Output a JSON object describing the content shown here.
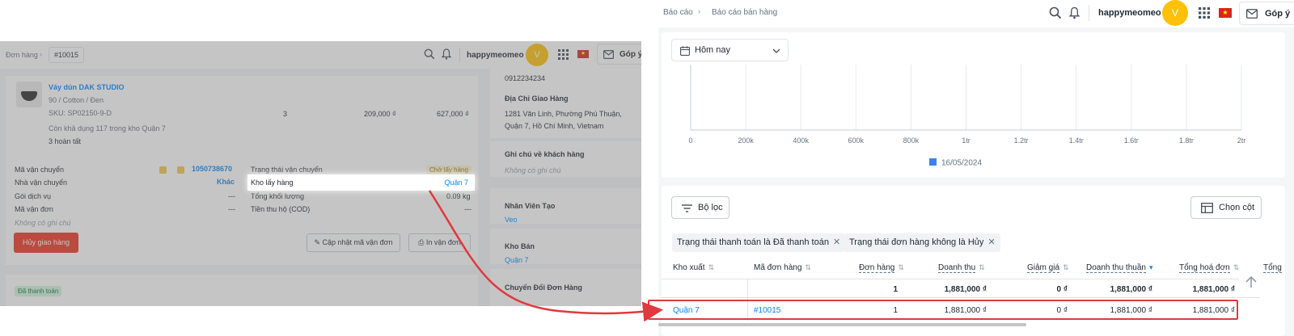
{
  "left_screen": {
    "breadcrumb": {
      "parent": "Đơn hàng",
      "current": "#10015"
    },
    "header": {
      "username": "happymeomeo",
      "avatar_letter": "V",
      "feedback_label": "Góp ý"
    },
    "product": {
      "name": "Váy dún DAK STUDIO",
      "variant": "90 / Cotton / Đen",
      "sku": "SKU: SP02150-9-D",
      "stock_note": "Còn khả dụng 117 trong kho Quận 7",
      "completed": "3 hoàn tất",
      "quantity": "3",
      "unit_price": "209,000 ₫",
      "total": "627,000 ₫"
    },
    "shipping": {
      "tracking_label": "Mã vận chuyển",
      "tracking_value": "1050738670",
      "carrier_label": "Nhà vận chuyển",
      "carrier_value": "Khác",
      "service_label": "Gói dịch vụ",
      "service_value": "---",
      "waybill_label": "Mã vận đơn",
      "waybill_value": "---",
      "no_note": "Không có ghi chú",
      "status_label": "Trạng thái vận chuyển",
      "status_value": "Chờ lấy hàng",
      "warehouse_label": "Kho lấy hàng",
      "warehouse_value": "Quận 7",
      "weight_label": "Tổng khối lượng",
      "weight_value": "0.09 kg",
      "cod_label": "Tiền thu hộ (COD)",
      "cod_value": "---",
      "cancel_label": "Hủy giao hàng",
      "update_label": "Cập nhật mã vận đơn",
      "print_label": "In vận đơn"
    },
    "payment_badge": "Đã thanh toán",
    "side": {
      "phone": "0912234234",
      "address_title": "Địa Chỉ Giao Hàng",
      "address_line1": "1281 Văn Linh, Phường Phú Thuận,",
      "address_line2": "Quận 7, Hồ Chí Minh, Vietnam",
      "customer_note_title": "Ghi chú về khách hàng",
      "customer_note_value": "Không có ghi chú",
      "creator_title": "Nhân Viên Tạo",
      "creator_value": "Veo",
      "store_title": "Kho Bán",
      "store_value": "Quận 7",
      "convert_title": "Chuyển Đổi Đơn Hàng"
    }
  },
  "right_screen": {
    "breadcrumb": {
      "parent": "Báo cáo",
      "current": "Báo cáo bán hàng"
    },
    "header": {
      "username": "happymeomeo",
      "avatar_letter": "V",
      "feedback_label": "Góp ý"
    },
    "date_filter": "Hôm nay",
    "filter_button": "Bộ lọc",
    "columns_button": "Chọn cột",
    "filter_chips": [
      "Trạng thái thanh toán là Đã thanh toán",
      "Trạng thái đơn hàng không là Hủy"
    ],
    "table": {
      "headers": [
        "Kho xuất",
        "Mã đơn hàng",
        "Đơn hàng",
        "Doanh thu",
        "Giảm giá",
        "Doanh thu thuần",
        "Tổng hoá đơn",
        "Tổng"
      ],
      "summary": [
        "",
        "",
        "1",
        "1,881,000 ₫",
        "0 ₫",
        "1,881,000 ₫",
        "1,881,000 ₫"
      ],
      "rows": [
        [
          "Quận 7",
          "#10015",
          "1",
          "1,881,000 ₫",
          "0 ₫",
          "1,881,000 ₫",
          "1,881,000 ₫"
        ]
      ]
    },
    "colors": {
      "highlight": "#e0393e",
      "series": "#3b82f6",
      "link": "#0088ff"
    }
  },
  "chart_data": {
    "type": "bar",
    "orientation": "horizontal",
    "x_ticks": [
      "0",
      "200k",
      "400k",
      "600k",
      "800k",
      "1tr",
      "1.2tr",
      "1.4tr",
      "1.6tr",
      "1.8tr",
      "2tr"
    ],
    "xlim": [
      0,
      2000000
    ],
    "series": [
      {
        "name": "16/05/2024",
        "color": "#3b82f6",
        "values": []
      }
    ],
    "grid": true,
    "legend": "bottom"
  }
}
